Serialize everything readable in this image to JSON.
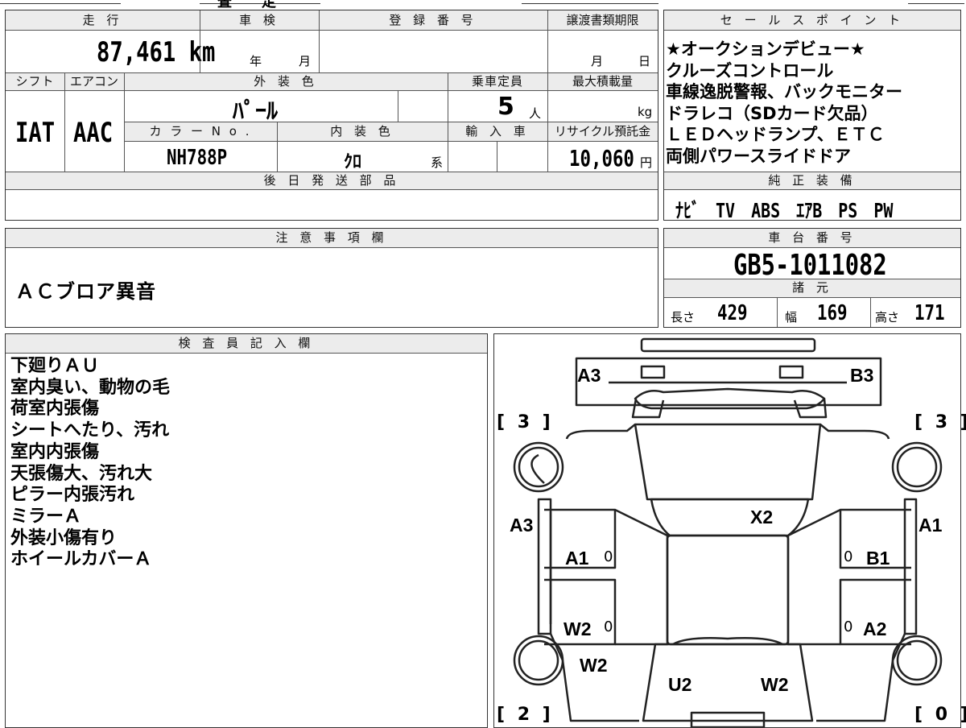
{
  "top_strip": {
    "frag_1": "査",
    "frag_2": "定"
  },
  "basic_info": {
    "mileage_label": "走 行",
    "mileage_value": "87,461 km",
    "inspection_label": "車 検",
    "inspection_year_unit": "年",
    "inspection_month_unit": "月",
    "registration_label": "登 録 番 号",
    "transfer_deadline_label": "譲渡書類期限",
    "transfer_month_unit": "月",
    "transfer_day_unit": "日",
    "shift_label": "シフト",
    "shift_value": "IAT",
    "aircon_label": "エアコン",
    "aircon_value": "AAC",
    "exterior_color_label": "外 装 色",
    "exterior_color_value": "ﾊﾟｰﾙ",
    "capacity_label": "乗車定員",
    "capacity_value": "5",
    "capacity_unit": "人",
    "max_load_label": "最大積載量",
    "max_load_unit": "kg",
    "color_no_label": "カ ラ ー N o .",
    "color_no_value": "NH788P",
    "interior_color_label": "内 装 色",
    "interior_color_value": "ｸﾛ",
    "interior_color_suffix": "系",
    "import_label": "輸 入 車",
    "recycle_label": "リサイクル預託金",
    "recycle_value": "10,060",
    "recycle_unit": "円",
    "later_parts_label": "後 日 発 送 部 品"
  },
  "sales_points": {
    "label": "セ ー ル ス ポ イ ン ト",
    "items": [
      "★オークションデビュー★",
      "クルーズコントロール",
      "車線逸脱警報、バックモニター",
      "ドラレコ（SDカード欠品）",
      "ＬＥＤヘッドランプ、ＥＴＣ",
      "両側パワースライドドア"
    ]
  },
  "equipment": {
    "label": "純 正 装 備",
    "value": "ﾅﾋﾞ　TV　ABS　ｴｱB　PS　PW"
  },
  "notes": {
    "label": "注 意 事 項 欄",
    "text": "ＡＣブロア異音"
  },
  "chassis": {
    "label": "車 台 番 号",
    "value": "GB5-1011082"
  },
  "dimensions": {
    "label": "諸 元",
    "length_label": "長さ",
    "length_value": "429",
    "width_label": "幅",
    "width_value": "169",
    "height_label": "高さ",
    "height_value": "171"
  },
  "inspector": {
    "label": "検 査 員 記 入 欄",
    "lines": [
      "下廻りＡＵ",
      "室内臭い、動物の毛",
      "荷室内張傷",
      "シートへたり、汚れ",
      "室内内張傷",
      "天張傷大、汚れ大",
      "ピラー内張汚れ",
      "ミラーＡ",
      "外装小傷有り",
      "ホイールカバーＡ"
    ]
  },
  "car_map": {
    "front_left": "A3",
    "front_right": "B3",
    "tire_fl": "[ 3 ]",
    "tire_fr": "[ 3 ]",
    "tire_rl": "[ 2 ]",
    "tire_rr": "[ 0 ]",
    "left_side": "A3",
    "right_side": "A1",
    "windshield_zone": "X2",
    "fl_door": "A1",
    "fr_door": "B1",
    "rl_door": "W2",
    "rr_door": "A2",
    "rear_left_quarter": "W2",
    "rear_center": "U2",
    "rear_right": "W2",
    "zero": "0"
  }
}
